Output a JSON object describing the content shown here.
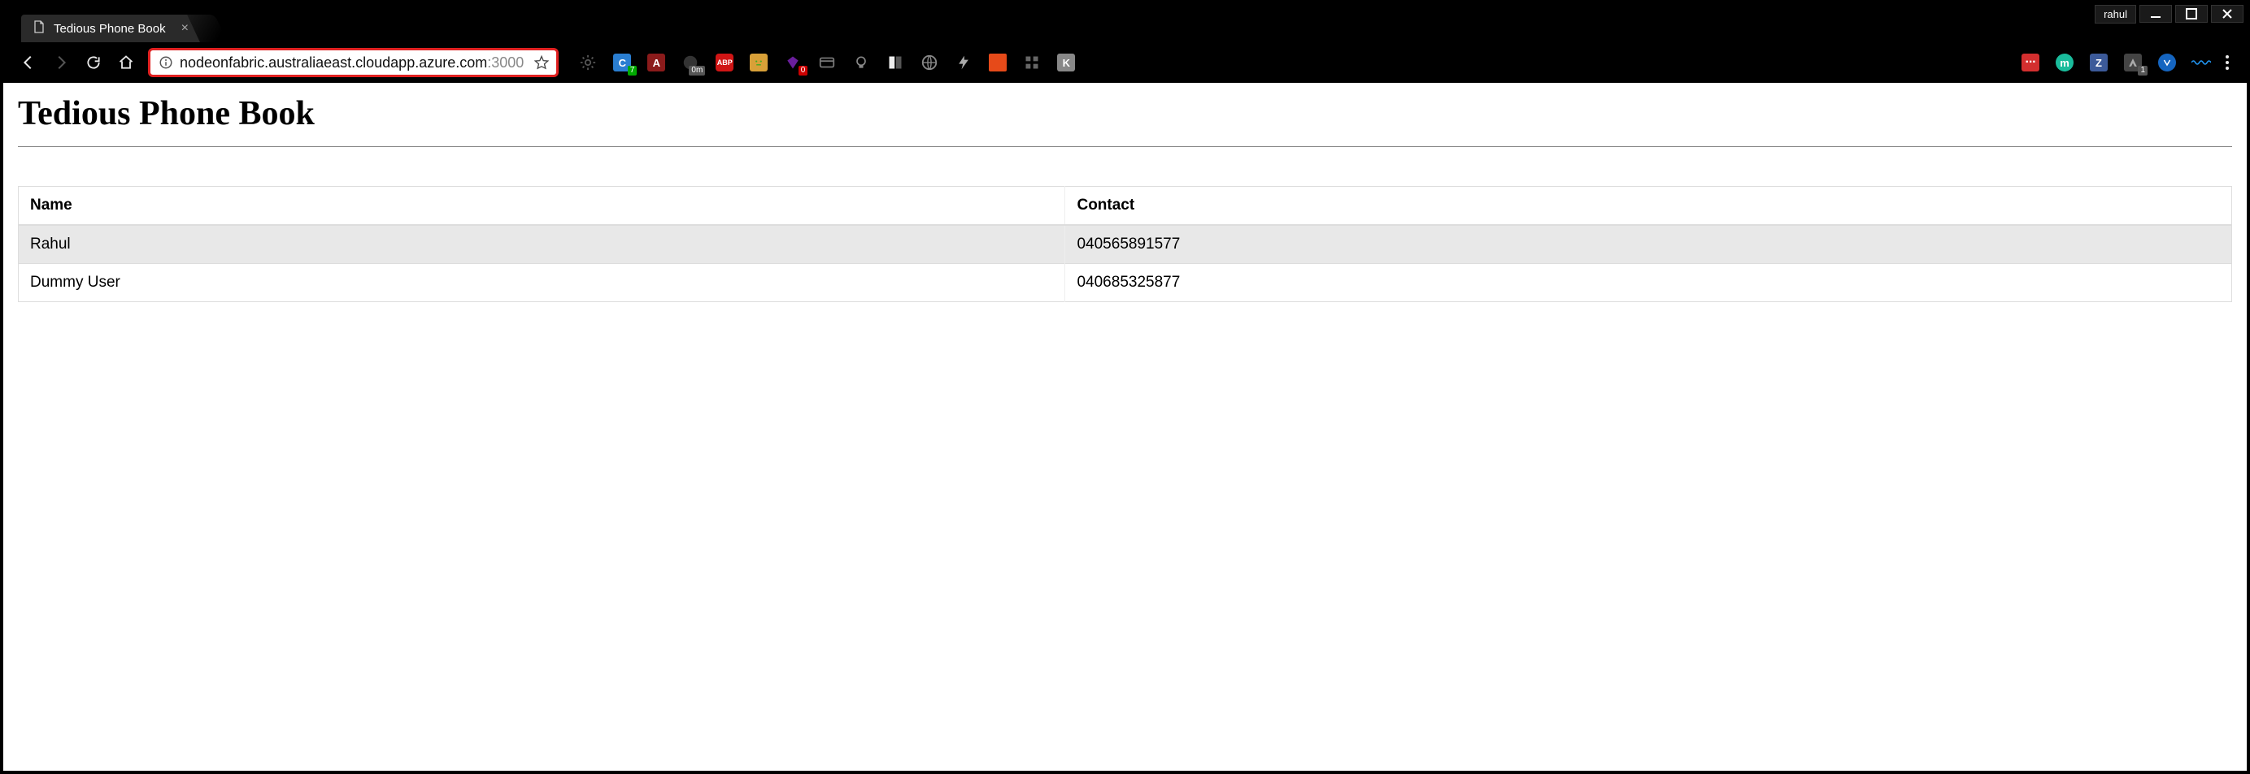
{
  "window": {
    "user_label": "rahul"
  },
  "tab": {
    "title": "Tedious Phone Book"
  },
  "address": {
    "host": "nodeonfabric.australiaeast.cloudapp.azure.com",
    "port": ":3000"
  },
  "extensions": {
    "c_badge": "7",
    "om_badge": "0m",
    "abp_label": "ABP",
    "red_badge": "0",
    "gray_badge": "1"
  },
  "page": {
    "heading": "Tedious Phone Book",
    "table": {
      "headers": [
        "Name",
        "Contact"
      ],
      "rows": [
        {
          "name": "Rahul",
          "contact": "040565891577"
        },
        {
          "name": "Dummy User",
          "contact": "040685325877"
        }
      ]
    }
  }
}
